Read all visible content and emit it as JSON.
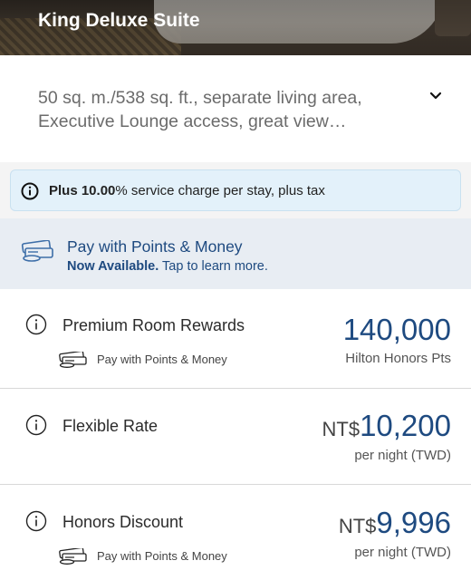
{
  "room": {
    "title": "King Deluxe Suite",
    "description": "50 sq. m./538 sq. ft., separate living area, Executive Lounge access, great view…"
  },
  "service_notice": {
    "bold": "Plus 10.00",
    "rest": "% service charge per stay, plus tax"
  },
  "points_money_banner": {
    "title": "Pay with Points & Money",
    "now_available": "Now Available.",
    "learn_more": " Tap to learn more."
  },
  "rates": [
    {
      "name": "Premium Room Rewards",
      "currency": "",
      "amount": "140,000",
      "sub": "Hilton Honors Pts",
      "pay_label": "Pay with Points & Money"
    },
    {
      "name": "Flexible Rate",
      "currency": "NT$",
      "amount": "10,200",
      "sub": "per night (TWD)"
    },
    {
      "name": "Honors Discount",
      "currency": "NT$",
      "amount": "9,996",
      "sub": "per night (TWD)",
      "pay_label": "Pay with Points & Money"
    }
  ],
  "colors": {
    "brand_blue": "#1e4a80",
    "notice_bg": "#e3f1fa",
    "banner_bg": "#e8edf3"
  }
}
